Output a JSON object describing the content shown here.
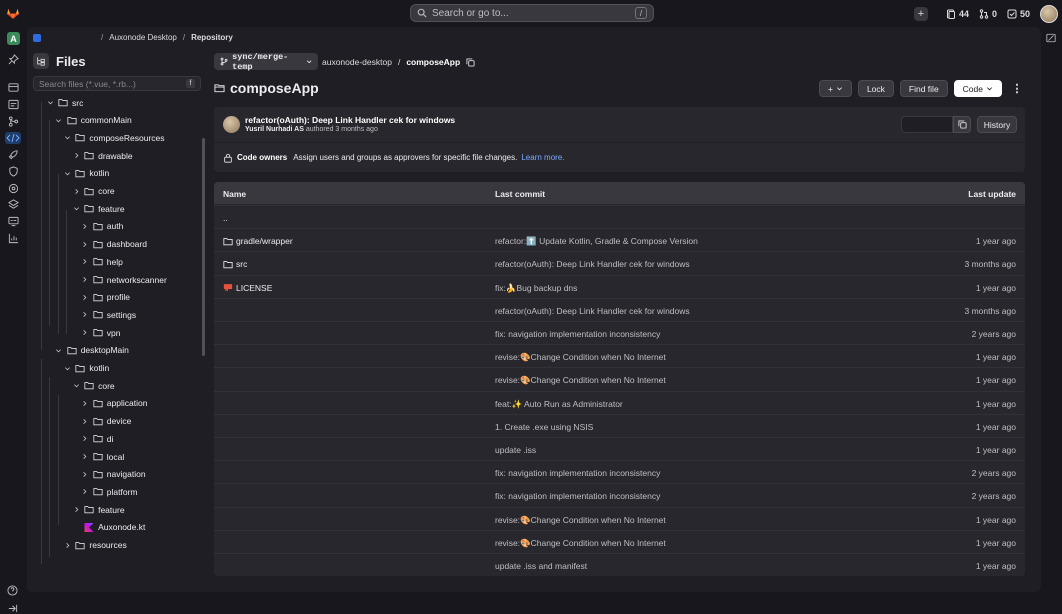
{
  "topbar": {
    "search_placeholder": "Search or go to...",
    "search_shortcut": "/",
    "counts": {
      "issues": "44",
      "merge_requests": "0",
      "todos": "50"
    }
  },
  "left_rail": {
    "project_initial": "A"
  },
  "breadcrumb": {
    "items": [
      "Auxonode Desktop",
      "Repository"
    ]
  },
  "files_panel": {
    "title": "Files",
    "filter_placeholder": "Search files (*.vue, *.rb...)",
    "filter_shortcut": "f",
    "tree": [
      {
        "label": "src",
        "indent": 0,
        "type": "folder",
        "open": true
      },
      {
        "label": "commonMain",
        "indent": 1,
        "type": "folder",
        "open": true
      },
      {
        "label": "composeResources",
        "indent": 2,
        "type": "folder",
        "open": true
      },
      {
        "label": "drawable",
        "indent": 3,
        "type": "folder",
        "open": false
      },
      {
        "label": "kotlin",
        "indent": 2,
        "type": "folder",
        "open": true
      },
      {
        "label": "core",
        "indent": 3,
        "type": "folder",
        "open": false
      },
      {
        "label": "feature",
        "indent": 3,
        "type": "folder",
        "open": true
      },
      {
        "label": "auth",
        "indent": 4,
        "type": "folder",
        "open": false
      },
      {
        "label": "dashboard",
        "indent": 4,
        "type": "folder",
        "open": false
      },
      {
        "label": "help",
        "indent": 4,
        "type": "folder",
        "open": false
      },
      {
        "label": "networkscanner",
        "indent": 4,
        "type": "folder",
        "open": false
      },
      {
        "label": "profile",
        "indent": 4,
        "type": "folder",
        "open": false
      },
      {
        "label": "settings",
        "indent": 4,
        "type": "folder",
        "open": false
      },
      {
        "label": "vpn",
        "indent": 4,
        "type": "folder",
        "open": false
      },
      {
        "label": "desktopMain",
        "indent": 1,
        "type": "folder",
        "open": true
      },
      {
        "label": "kotlin",
        "indent": 2,
        "type": "folder",
        "open": true
      },
      {
        "label": "core",
        "indent": 3,
        "type": "folder",
        "open": true
      },
      {
        "label": "application",
        "indent": 4,
        "type": "folder",
        "open": false
      },
      {
        "label": "device",
        "indent": 4,
        "type": "folder",
        "open": false
      },
      {
        "label": "di",
        "indent": 4,
        "type": "folder",
        "open": false
      },
      {
        "label": "local",
        "indent": 4,
        "type": "folder",
        "open": false
      },
      {
        "label": "navigation",
        "indent": 4,
        "type": "folder",
        "open": false
      },
      {
        "label": "platform",
        "indent": 4,
        "type": "folder",
        "open": false
      },
      {
        "label": "feature",
        "indent": 3,
        "type": "folder",
        "open": false
      },
      {
        "label": "Auxonode.kt",
        "indent": 3,
        "type": "kotlin",
        "open": false
      },
      {
        "label": "resources",
        "indent": 2,
        "type": "folder",
        "open": false
      }
    ]
  },
  "repo": {
    "branch": "sync/merge-temp",
    "path_root": "auxonode-desktop",
    "path_sep": "/",
    "path_current": "composeApp",
    "title": "composeApp",
    "buttons": {
      "lock": "Lock",
      "find_file": "Find file",
      "code": "Code"
    }
  },
  "last_commit": {
    "title": "refactor(oAuth): Deep Link Handler cek for windows",
    "author": "Yusril Nurhadi AS",
    "authored": "authored",
    "time": "3 months ago",
    "history": "History"
  },
  "code_owners": {
    "label": "Code owners",
    "text": "Assign users and groups as approvers for specific file changes.",
    "link": "Learn more."
  },
  "table": {
    "headers": {
      "name": "Name",
      "commit": "Last commit",
      "update": "Last update"
    },
    "rows": [
      {
        "name": "..",
        "icon": "",
        "commit": "",
        "update": ""
      },
      {
        "name": "gradle/wrapper",
        "icon": "folder",
        "commit": "refactor:⬆️ Update Kotlin, Gradle & Compose Version",
        "update": "1 year ago"
      },
      {
        "name": "src",
        "icon": "folder",
        "commit": "refactor(oAuth): Deep Link Handler cek for windows",
        "update": "3 months ago"
      },
      {
        "name": "LICENSE",
        "icon": "license",
        "commit": "fix:🍌Bug backup dns",
        "update": "1 year ago"
      },
      {
        "name": "",
        "icon": "",
        "commit": "refactor(oAuth): Deep Link Handler cek for windows",
        "update": "3 months ago"
      },
      {
        "name": "",
        "icon": "",
        "commit": "fix: navigation implementation inconsistency",
        "update": "2 years ago"
      },
      {
        "name": "",
        "icon": "",
        "commit": "revise:🎨Change Condition when No Internet",
        "update": "1 year ago"
      },
      {
        "name": "",
        "icon": "",
        "commit": "revise:🎨Change Condition when No Internet",
        "update": "1 year ago"
      },
      {
        "name": "",
        "icon": "",
        "commit": "feat:✨ Auto Run as Administrator",
        "update": "1 year ago"
      },
      {
        "name": "",
        "icon": "",
        "commit": "1. Create .exe using NSIS",
        "update": "1 year ago"
      },
      {
        "name": "",
        "icon": "",
        "commit": "update .iss",
        "update": "1 year ago"
      },
      {
        "name": "",
        "icon": "",
        "commit": "fix: navigation implementation inconsistency",
        "update": "2 years ago"
      },
      {
        "name": "",
        "icon": "",
        "commit": "fix: navigation implementation inconsistency",
        "update": "2 years ago"
      },
      {
        "name": "",
        "icon": "",
        "commit": "revise:🎨Change Condition when No Internet",
        "update": "1 year ago"
      },
      {
        "name": "",
        "icon": "",
        "commit": "revise:🎨Change Condition when No Internet",
        "update": "1 year ago"
      },
      {
        "name": "",
        "icon": "",
        "commit": "update .iss and manifest",
        "update": "1 year ago"
      }
    ]
  }
}
